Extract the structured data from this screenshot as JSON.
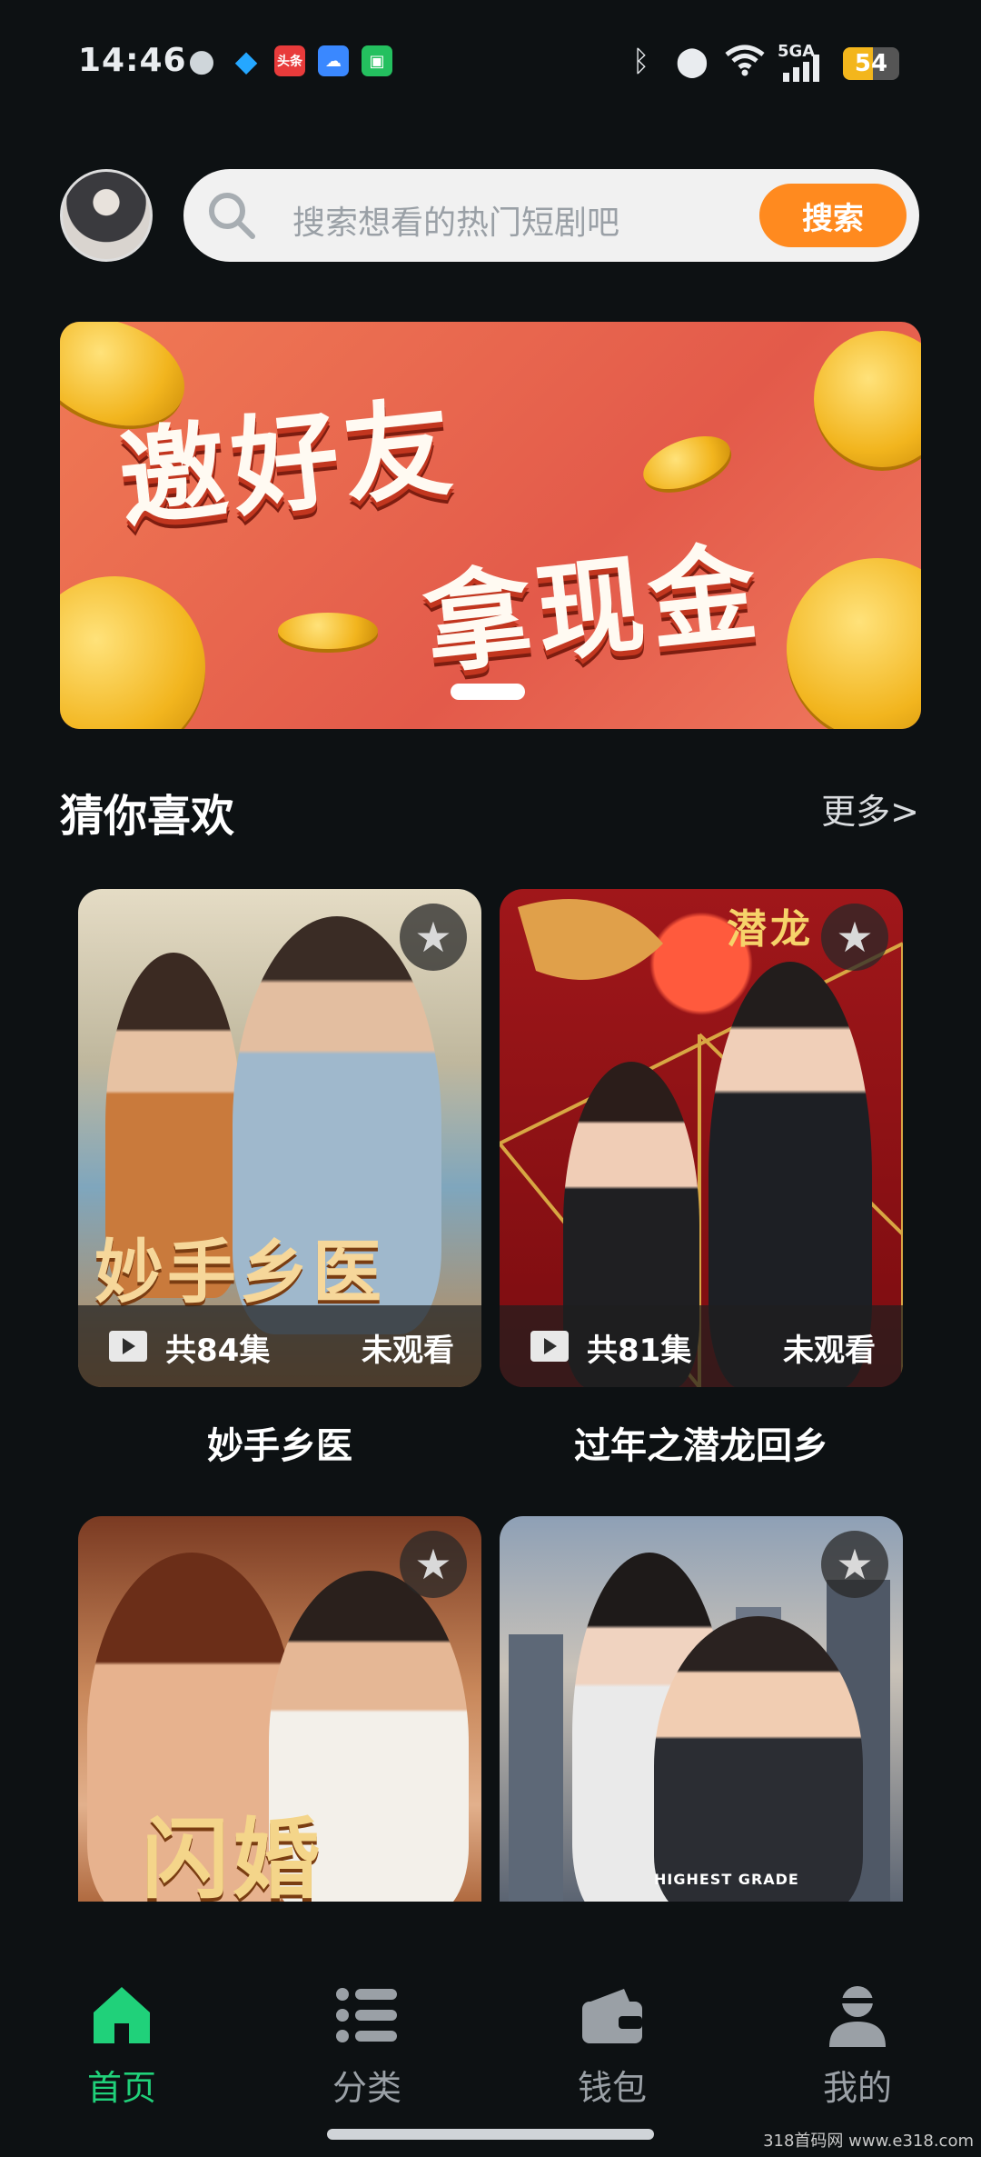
{
  "status_bar": {
    "time": "14:46",
    "apps": [
      "wechat-icon",
      "qq-icon",
      "toutiao-icon",
      "weather-icon",
      "mall-icon"
    ],
    "toutiao_label": "头条",
    "network": "5GA",
    "battery": "54",
    "battery_level": 0.54
  },
  "header": {
    "search_placeholder": "搜索想看的热门短剧吧",
    "search_button": "搜索"
  },
  "banner": {
    "line1": "邀好友",
    "line2": "拿现金",
    "accent": "#e35a4a"
  },
  "section": {
    "title": "猜你喜欢",
    "more": "更多>"
  },
  "dramas": [
    {
      "title": "妙手乡医",
      "poster_text": "妙手乡医",
      "episodes": "共84集",
      "status": "未观看"
    },
    {
      "title": "过年之潜龙回乡",
      "poster_text": "潜龙",
      "episodes": "共81集",
      "status": "未观看"
    },
    {
      "title": "",
      "poster_text": "闪婚",
      "episodes": "",
      "status": ""
    },
    {
      "title": "",
      "poster_text": "HIGHEST GRADE",
      "episodes": "",
      "status": ""
    }
  ],
  "nav": {
    "items": [
      {
        "label": "首页",
        "icon": "home-icon",
        "active": true
      },
      {
        "label": "分类",
        "icon": "list-icon",
        "active": false
      },
      {
        "label": "钱包",
        "icon": "wallet-icon",
        "active": false
      },
      {
        "label": "我的",
        "icon": "user-icon",
        "active": false
      }
    ],
    "active_color": "#20d17a"
  },
  "watermark": "318首码网 www.e318.com"
}
